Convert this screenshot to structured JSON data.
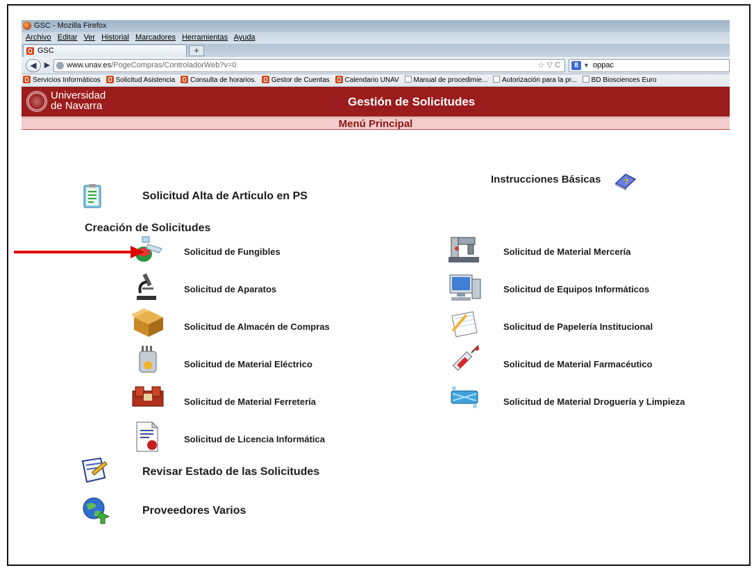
{
  "browser": {
    "window_title": "GSC - Mozilla Firefox",
    "menu": [
      "Archivo",
      "Editar",
      "Ver",
      "Historial",
      "Marcadores",
      "Herramientas",
      "Ayuda"
    ],
    "tab_label": "GSC",
    "newtab_label": "+",
    "url_host": "www.unav.es",
    "url_path": "/PogeCompras/ControladorWeb?v=0",
    "url_controls": "☆ ▽ C",
    "search_engine": "8",
    "search_value": "oppac",
    "bookmarks": [
      {
        "label": "Servicios Informáticos",
        "icon": "unav-icon"
      },
      {
        "label": "Solicitud Asistencia",
        "icon": "unav-icon"
      },
      {
        "label": "Consulta de horarios.",
        "icon": "unav-icon"
      },
      {
        "label": "Gestor de Cuentas",
        "icon": "unav-icon"
      },
      {
        "label": "Calendario UNAV",
        "icon": "unav-icon"
      },
      {
        "label": "Manual de procedimie...",
        "icon": "page-icon"
      },
      {
        "label": "Autorización para la pr...",
        "icon": "page-icon"
      },
      {
        "label": "BD Biosciences Euro",
        "icon": "page-icon"
      }
    ]
  },
  "header": {
    "logo_line1": "Universidad",
    "logo_line2": "de Navarra",
    "title": "Gestión de Solicitudes"
  },
  "menu_title": "Menú Principal",
  "instructions_label": "Instrucciones Básicas",
  "top_item": "Solicitud Alta de Articulo en PS",
  "section_title": "Creación de Solicitudes",
  "left_items": [
    "Solicitud de Fungibles",
    "Solicitud de Aparatos",
    "Solicitud de Almacén de Compras",
    "Solicitud de Material Eléctrico",
    "Solicitud de Material Ferretería",
    "Solicitud de Licencia Informática"
  ],
  "right_items": [
    "Solicitud de Material Mercería",
    "Solicitud de Equipos Informáticos",
    "Solicitud de Papelería Institucional",
    "Solicitud de Material Farmacéutico",
    "Solicitud de Material Droguería y Limpieza"
  ],
  "bottom_items": [
    "Revisar Estado de las Solicitudes",
    "Proveedores Varios"
  ],
  "colors": {
    "header_red": "#9b1c1c",
    "menu_band": "#f3cccc",
    "annotation_arrow": "#e00000"
  }
}
